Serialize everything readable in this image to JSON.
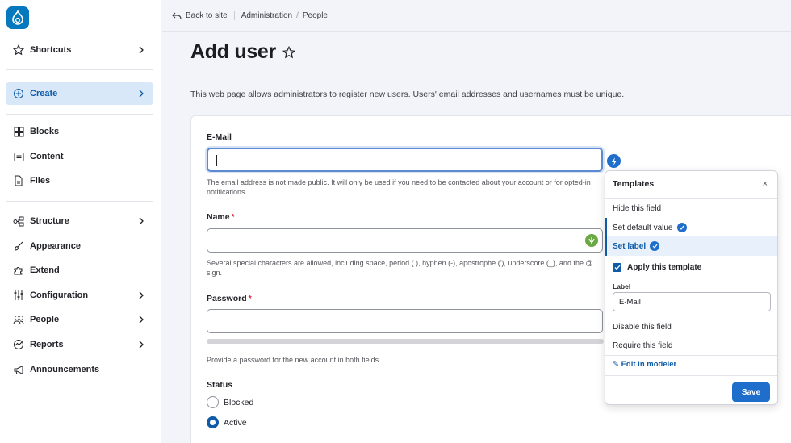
{
  "topbar": {
    "back": "Back to site",
    "crumbs": [
      "Administration",
      "People"
    ]
  },
  "page": {
    "title": "Add user",
    "description": "This web page allows administrators to register new users. Users' email addresses and usernames must be unique."
  },
  "sidebar": {
    "items": [
      {
        "label": "Shortcuts",
        "icon": "star-icon"
      },
      {
        "label": "Create",
        "icon": "plus-circle-icon"
      },
      {
        "label": "Blocks",
        "icon": "blocks-icon"
      },
      {
        "label": "Content",
        "icon": "content-icon"
      },
      {
        "label": "Files",
        "icon": "file-icon"
      },
      {
        "label": "Structure",
        "icon": "structure-icon"
      },
      {
        "label": "Appearance",
        "icon": "brush-icon"
      },
      {
        "label": "Extend",
        "icon": "puzzle-icon"
      },
      {
        "label": "Configuration",
        "icon": "sliders-icon"
      },
      {
        "label": "People",
        "icon": "people-icon"
      },
      {
        "label": "Reports",
        "icon": "reports-icon"
      },
      {
        "label": "Announcements",
        "icon": "megaphone-icon"
      }
    ]
  },
  "form": {
    "email": {
      "label": "E-Mail",
      "value": "",
      "help": "The email address is not made public. It will only be used if you need to be contacted about your account or for opted-in notifications."
    },
    "name": {
      "label": "Name",
      "required_mark": "*",
      "value": "",
      "help": "Several special characters are allowed, including space, period (.), hyphen (-), apostrophe ('), underscore (_), and the @ sign."
    },
    "password": {
      "label": "Password",
      "required_mark": "*",
      "value": "",
      "help": "Provide a password for the new account in both fields."
    },
    "status": {
      "label": "Status",
      "options": [
        "Blocked",
        "Active"
      ],
      "selected": "Active"
    }
  },
  "templates_popup": {
    "title": "Templates",
    "close": "×",
    "items": [
      "Hide this field",
      "Set default value",
      "Set label",
      "Apply this template",
      "Disable this field",
      "Require this field"
    ],
    "label_heading": "Label",
    "label_value": "E-Mail",
    "edit_link": "✎ Edit in modeler",
    "save": "Save"
  },
  "colors": {
    "accent": "#1f6ecb",
    "active_nav_bg": "#d8e8f8",
    "required": "#d6253b"
  }
}
